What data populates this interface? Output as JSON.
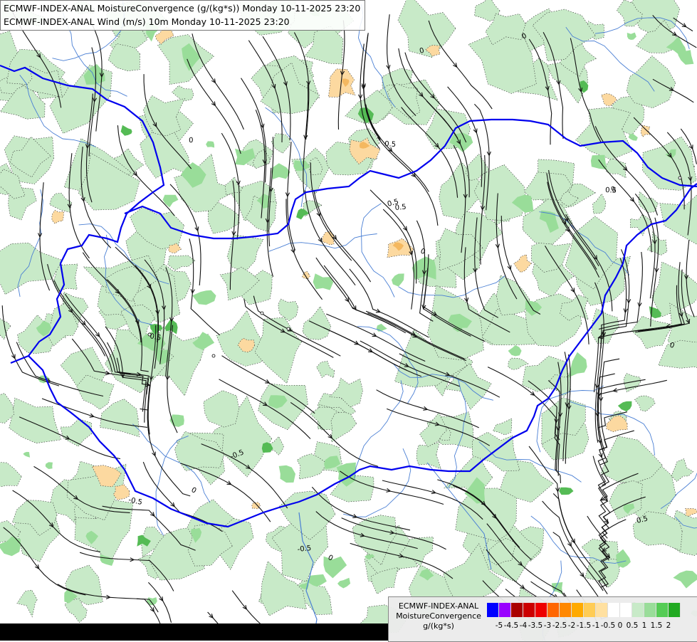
{
  "header": {
    "line1": "ECMWF-INDEX-ANAL MoistureConvergence (g/(kg*s)) Monday 10-11-2025 23:20",
    "line2": "ECMWF-INDEX-ANAL Wind (m/s) 10m Monday 10-11-2025 23:20"
  },
  "legend": {
    "title_line1": "ECMWF-INDEX-ANAL",
    "title_line2": "MoistureConvergence",
    "title_line3": "g/(kg*s)",
    "colors": [
      "#0000ff",
      "#9900ff",
      "#aa0000",
      "#cc0000",
      "#ee0000",
      "#ff6600",
      "#ff8800",
      "#ffaa00",
      "#ffcc55",
      "#ffe0a0",
      "#ffffff",
      "#ffffff",
      "#c8eac8",
      "#99dd99",
      "#55cc55",
      "#22aa22"
    ],
    "ticks": [
      "-5",
      "-4.5",
      "-4",
      "-3.5",
      "-3",
      "-2.5",
      "-2",
      "-1.5",
      "-1",
      "-0.5",
      "0",
      "0.5",
      "1",
      "1.5",
      "2"
    ]
  },
  "contour_labels": [
    "0",
    "0",
    "0.5",
    "0",
    "-0.5",
    "0.5",
    "-0.5",
    "0",
    "0.5",
    "0.5",
    "0",
    "0",
    "-0.5",
    "0.5",
    "0",
    "0.5",
    "0"
  ],
  "colors": {
    "border": "#0000ee",
    "river": "#4a7fd4",
    "green_light": "#c8eac8",
    "green_mid": "#99dd99",
    "green_dark": "#55bb55",
    "orange": "#fcd9a0",
    "orange_dark": "#f4b860"
  }
}
